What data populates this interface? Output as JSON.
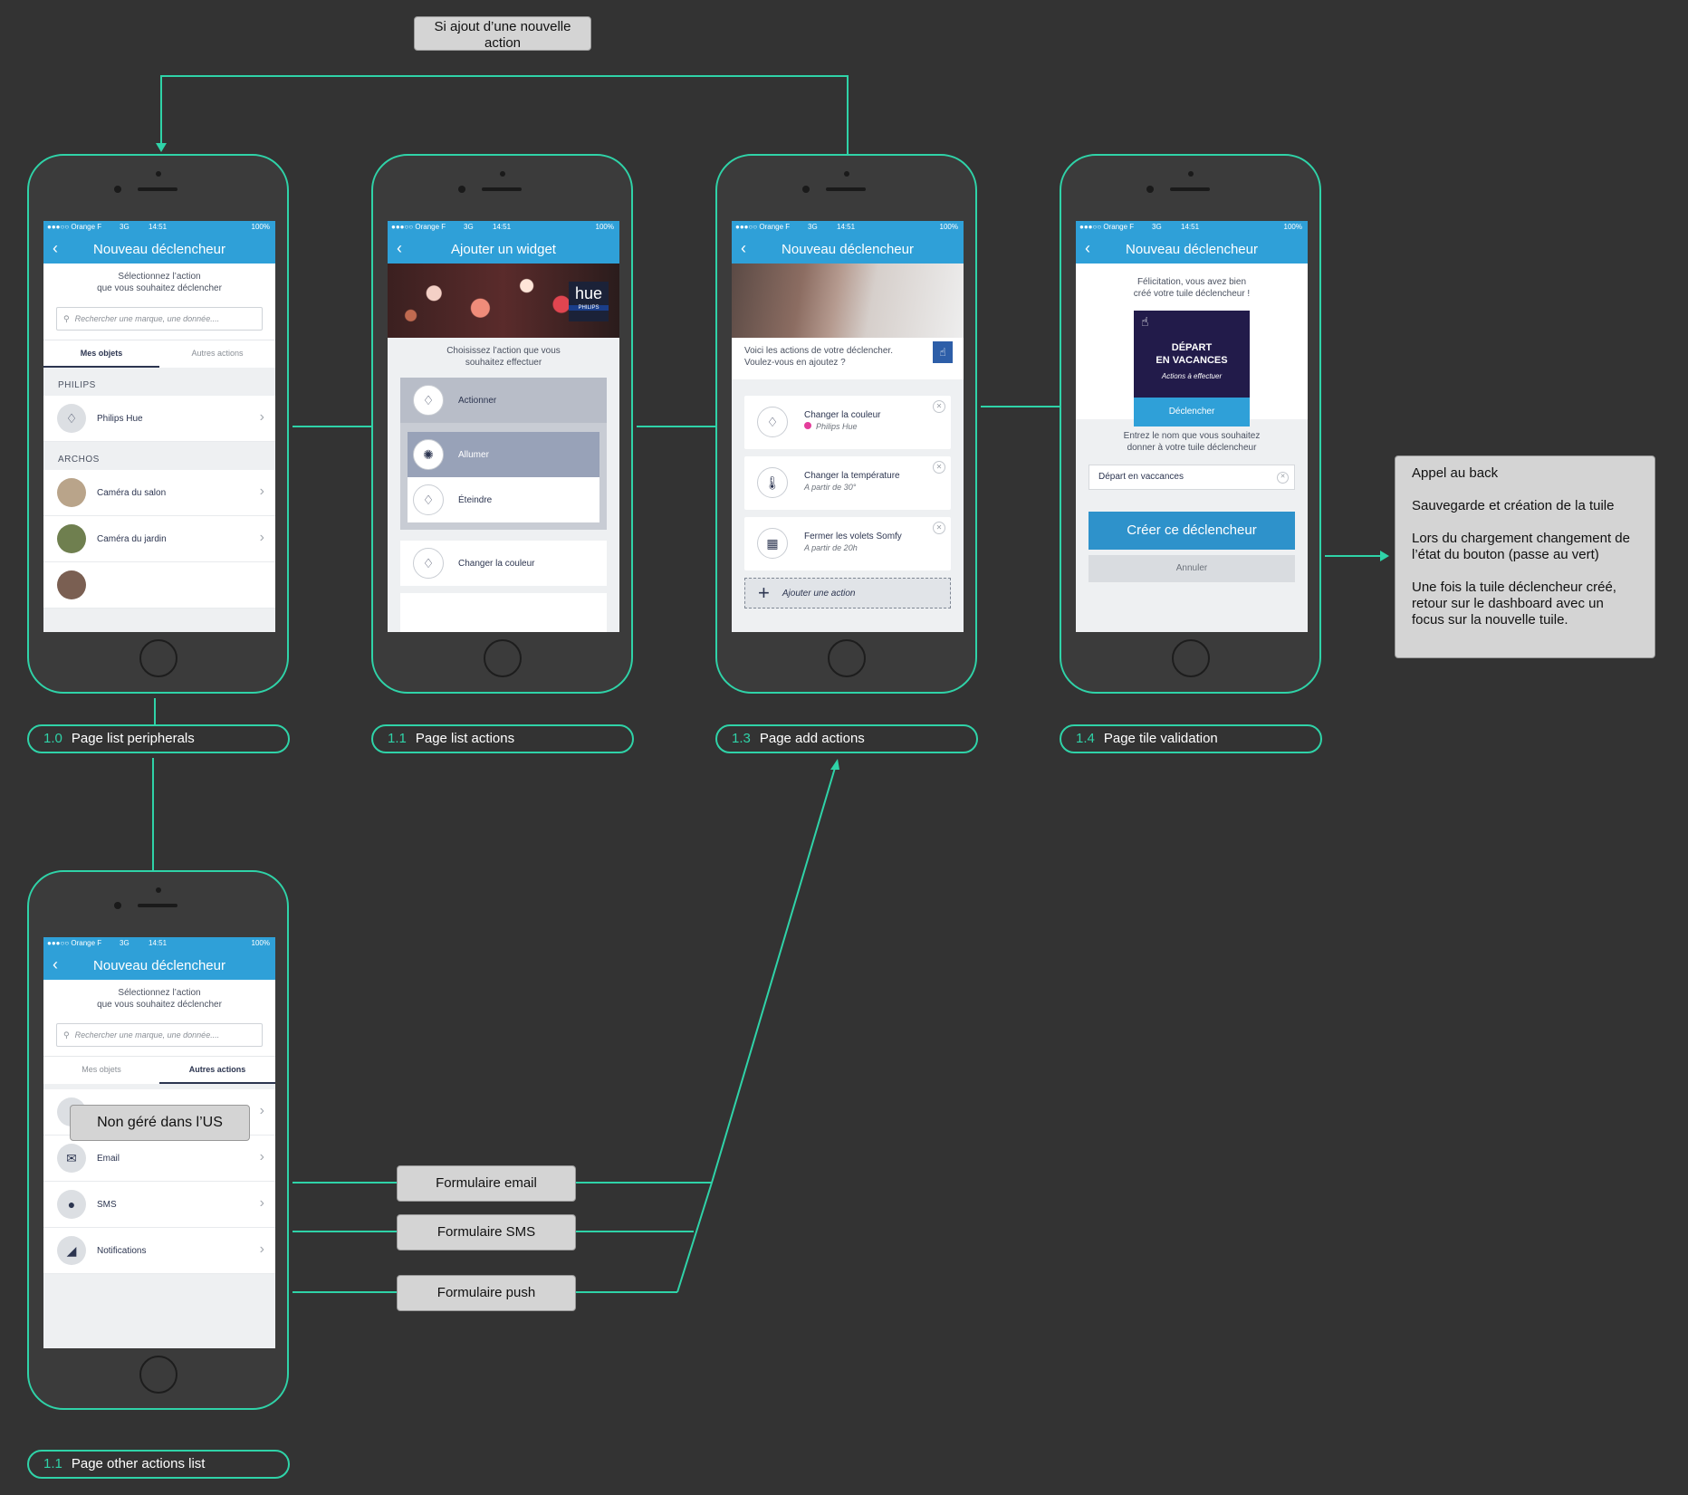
{
  "note_top": "Si ajout d’une nouvelle action",
  "note_backend": {
    "l1": "Appel au back",
    "l2": "Sauvegarde et création de la tuile",
    "l3": "Lors du chargement changement de l’état du bouton (passe au vert)",
    "l4": "Une fois la tuile déclencheur créé, retour sur le dashboard avec un focus sur la nouvelle tuile."
  },
  "note_us": "Non géré dans l’US",
  "form_email": "Formulaire email",
  "form_sms": "Formulaire SMS",
  "form_push": "Formulaire push",
  "status": {
    "carrier": "●●●○○ Orange F",
    "network": "3G",
    "time": "14:51",
    "battery": "100%"
  },
  "captions": [
    {
      "num": "1.0",
      "label": "Page list peripherals"
    },
    {
      "num": "1.1",
      "label": "Page list actions"
    },
    {
      "num": "1.3",
      "label": "Page add actions"
    },
    {
      "num": "1.4",
      "label": "Page tile validation"
    },
    {
      "num": "1.1",
      "label": "Page other actions list"
    }
  ],
  "screen1": {
    "title": "Nouveau déclencheur",
    "intro_l1": "Sélectionnez l’action",
    "intro_l2": "que vous souhaitez déclencher",
    "search_placeholder": "Rechercher une marque, une donnée....",
    "tab_mine": "Mes objets",
    "tab_other": "Autres actions",
    "section_philips": "PHILIPS",
    "item_hue": "Philips Hue",
    "section_archos": "ARCHOS",
    "item_cam1": "Caméra du salon",
    "item_cam2": "Caméra du jardin"
  },
  "screen2": {
    "title": "Ajouter un widget",
    "hue_logo": "hue",
    "hue_brand": "PHILIPS",
    "intro_l1": "Choisissez l’action que vous",
    "intro_l2": "souhaitez effectuer",
    "a_actionner": "Actionner",
    "a_allumer": "Allumer",
    "a_eteindre": "Éteindre",
    "a_couleur": "Changer la couleur"
  },
  "screen3": {
    "title": "Nouveau déclencheur",
    "intro_l1": "Voici les actions de votre déclencher.",
    "intro_l2": "Voulez-vous en ajoutez ?",
    "c1_t": "Changer la couleur",
    "c1_s": "Philips Hue",
    "c2_t": "Changer la température",
    "c2_s": "A partir de 30°",
    "c3_t": "Fermer les volets Somfy",
    "c3_s": "A partir de 20h",
    "add": "Ajouter une action"
  },
  "screen4": {
    "title": "Nouveau déclencheur",
    "intro_l1": "Félicitation, vous avez bien",
    "intro_l2": "créé votre tuile déclencheur !",
    "tile_l1": "DÉPART",
    "tile_l2": "EN VACANCES",
    "tile_sub": "Actions à effectuer",
    "tile_btn": "Déclencher",
    "name_l1": "Entrez le nom que vous souhaitez",
    "name_l2": "donner à votre tuile déclencheur",
    "name_value": "Départ en vaccances",
    "create": "Créer ce déclencheur",
    "cancel": "Annuler"
  },
  "screen5": {
    "title": "Nouveau déclencheur",
    "intro_l1": "Sélectionnez l’action",
    "intro_l2": "que vous souhaitez déclencher",
    "search_placeholder": "Rechercher une marque, une donnée....",
    "tab_mine": "Mes objets",
    "tab_other": "Autres actions",
    "item_email": "Email",
    "item_sms": "SMS",
    "item_notif": "Notifications"
  },
  "colors": {
    "accent": "#2fd3a8",
    "ios_blue": "#2fa0d8",
    "navy": "#2c3550"
  }
}
